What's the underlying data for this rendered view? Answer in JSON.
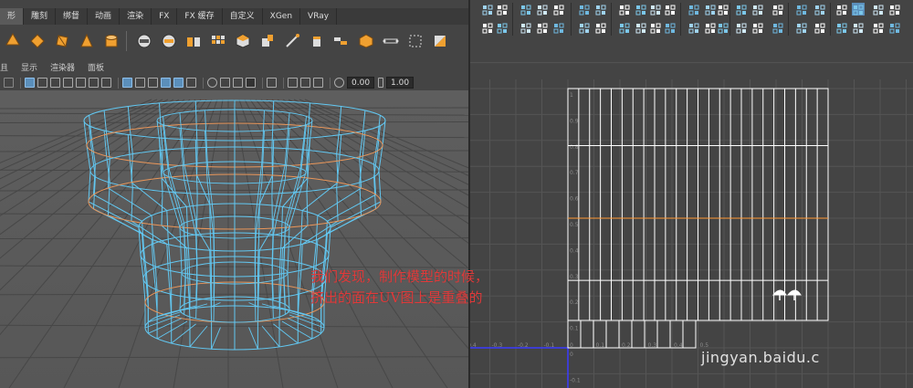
{
  "maya": {
    "shelf_tabs": [
      "形",
      "雕刻",
      "绑督",
      "动画",
      "渲染",
      "FX",
      "FX 缓存",
      "自定义",
      "XGen",
      "VRay"
    ],
    "active_shelf_tab": 0,
    "shelf_icons": [
      "sphere-icon",
      "cube-icon",
      "cylinder-icon",
      "cone-icon",
      "torus-icon",
      "combine-icon",
      "separate-icon",
      "extract-icon",
      "smooth-icon",
      "bridge-icon",
      "extrude-icon",
      "bevel-icon",
      "multicut-icon",
      "target-weld-icon",
      "merge-icon",
      "uv-planar-icon",
      "uv-auto-icon",
      "uv-editor-icon",
      "uv-layout-icon"
    ],
    "panel_menu": [
      "且",
      "显示",
      "渲染器",
      "面板"
    ],
    "fields": {
      "exposure": "0.00",
      "gamma": "1.00"
    },
    "accent": "#5b8fbb"
  },
  "uv_editor": {
    "toolbar_row1_icons": [
      "uv-select-icon",
      "shell-select-icon",
      "pin-icon",
      "cut-icon",
      "sew-icon",
      "flip-icon",
      "rotate-icon",
      "straighten-icon",
      "align-icon",
      "distribute-icon",
      "snap-icon",
      "checker-icon",
      "texture-icon"
    ],
    "toolbar_row2_icons": [
      "tweak-icon",
      "lattice-icon",
      "smudge-icon",
      "grab-icon",
      "pinch-icon",
      "unfold-icon",
      "optimize-icon",
      "layout-icon",
      "grid-icon",
      "shaded-icon"
    ],
    "axis_labels_v": [
      "1",
      "0.9",
      "0.8",
      "0.7",
      "0.6",
      "0.5",
      "0.4",
      "0.3",
      "0.2",
      "0.1",
      "0",
      "-0.1"
    ],
    "axis_labels_u": [
      "-0.4",
      "-0.3",
      "-0.2",
      "-0.1",
      "0",
      "0.1",
      "0.2",
      "0.3",
      "0.4",
      "0.5"
    ],
    "uv_shell_color": "#ffffff",
    "seam_color": "#ff9933",
    "uv_axis_color": "#3b3bff"
  },
  "annotation": {
    "line1": "我们发现，制作模型的时候，",
    "line2": "挤出的面在UV图上是重叠的",
    "color": "#e03a3a"
  },
  "watermark": "jingyan.baidu.c"
}
